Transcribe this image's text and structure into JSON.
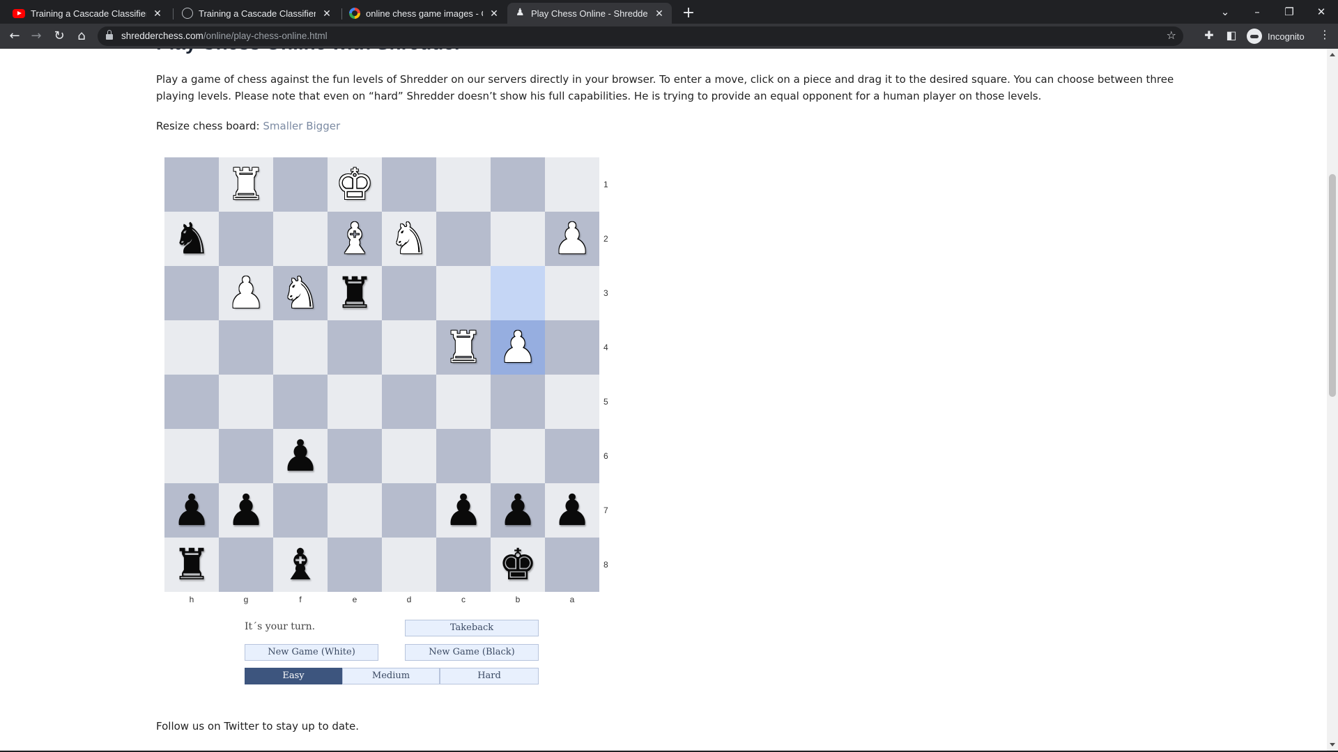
{
  "browser": {
    "tabs": [
      {
        "title": "Training a Cascade Classifier - Op",
        "favicon": "youtube-icon",
        "active": false
      },
      {
        "title": "Training a Cascade Classifier - Le",
        "favicon": "globe-icon",
        "active": false
      },
      {
        "title": "online chess game images - Goo",
        "favicon": "google-icon",
        "active": false
      },
      {
        "title": "Play Chess Online - Shredder Che",
        "favicon": "shredder-icon",
        "active": true
      }
    ],
    "url_host": "shredderchess.com",
    "url_path": "/online/play-chess-online.html",
    "profile_label": "Incognito"
  },
  "page": {
    "title": "Play Chess Online with Shredder",
    "intro": "Play a game of chess against the fun levels of Shredder on our servers directly in your browser. To enter a move, click on a piece and drag it to the desired square. You can choose between three playing levels. Please note that even on “hard” Shredder doesn’t show his full capabilities. He is trying to provide an equal opponent for a human player on those levels.",
    "resize_label": "Resize chess board:",
    "resize_smaller": "Smaller",
    "resize_bigger": "Bigger",
    "status_text": "It´s your turn.",
    "takeback_label": "Takeback",
    "new_game_white_label": "New Game (White)",
    "new_game_black_label": "New Game (Black)",
    "levels": [
      {
        "label": "Easy",
        "selected": true
      },
      {
        "label": "Medium",
        "selected": false
      },
      {
        "label": "Hard",
        "selected": false
      }
    ],
    "follow_text": "Follow us on Twitter to stay up to date."
  },
  "board": {
    "orientation": "black-bottom",
    "files": [
      "h",
      "g",
      "f",
      "e",
      "d",
      "c",
      "b",
      "a"
    ],
    "ranks": [
      "1",
      "2",
      "3",
      "4",
      "5",
      "6",
      "7",
      "8"
    ],
    "last_move": {
      "from": "b3",
      "to": "b4"
    },
    "pieces": {
      "g1": {
        "color": "white",
        "type": "rook",
        "glyph": "♜"
      },
      "e1": {
        "color": "white",
        "type": "king",
        "glyph": "♚"
      },
      "h2": {
        "color": "black",
        "type": "knight",
        "glyph": "♞"
      },
      "e2": {
        "color": "white",
        "type": "bishop",
        "glyph": "♝"
      },
      "d2": {
        "color": "white",
        "type": "knight",
        "glyph": "♞"
      },
      "a2": {
        "color": "white",
        "type": "pawn",
        "glyph": "♟"
      },
      "g3": {
        "color": "white",
        "type": "pawn",
        "glyph": "♟"
      },
      "f3": {
        "color": "white",
        "type": "knight",
        "glyph": "♞"
      },
      "e3": {
        "color": "black",
        "type": "rook",
        "glyph": "♜"
      },
      "c4": {
        "color": "white",
        "type": "rook",
        "glyph": "♜"
      },
      "b4": {
        "color": "white",
        "type": "pawn",
        "glyph": "♟"
      },
      "f6": {
        "color": "black",
        "type": "pawn",
        "glyph": "♟"
      },
      "h7": {
        "color": "black",
        "type": "pawn",
        "glyph": "♟"
      },
      "g7": {
        "color": "black",
        "type": "pawn",
        "glyph": "♟"
      },
      "c7": {
        "color": "black",
        "type": "pawn",
        "glyph": "♟"
      },
      "b7": {
        "color": "black",
        "type": "pawn",
        "glyph": "♟"
      },
      "a7": {
        "color": "black",
        "type": "pawn",
        "glyph": "♟"
      },
      "h8": {
        "color": "black",
        "type": "rook",
        "glyph": "♜"
      },
      "f8": {
        "color": "black",
        "type": "bishop",
        "glyph": "♝"
      },
      "b8": {
        "color": "black",
        "type": "king",
        "glyph": "♚"
      }
    }
  },
  "colors": {
    "light_square": "#e9ebef",
    "dark_square": "#b6bccd",
    "highlight_from": "#c5d6f5",
    "highlight_to": "#96aee0",
    "button_bg": "#e8f0fd",
    "selected_level_bg": "#3d557e",
    "link": "#7b8aa2"
  }
}
